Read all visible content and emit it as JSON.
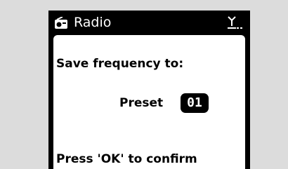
{
  "header": {
    "title": "Radio",
    "left_icon": "radio-icon",
    "right_icon": "antenna-signal-icon"
  },
  "content": {
    "prompt": "Save frequency to:",
    "preset_label": "Preset",
    "preset_value": "01",
    "confirm_text": "Press 'OK' to confirm"
  },
  "colors": {
    "background": "#dcdcdc",
    "screen": "#000000",
    "panel": "#ffffff",
    "text": "#000000"
  }
}
